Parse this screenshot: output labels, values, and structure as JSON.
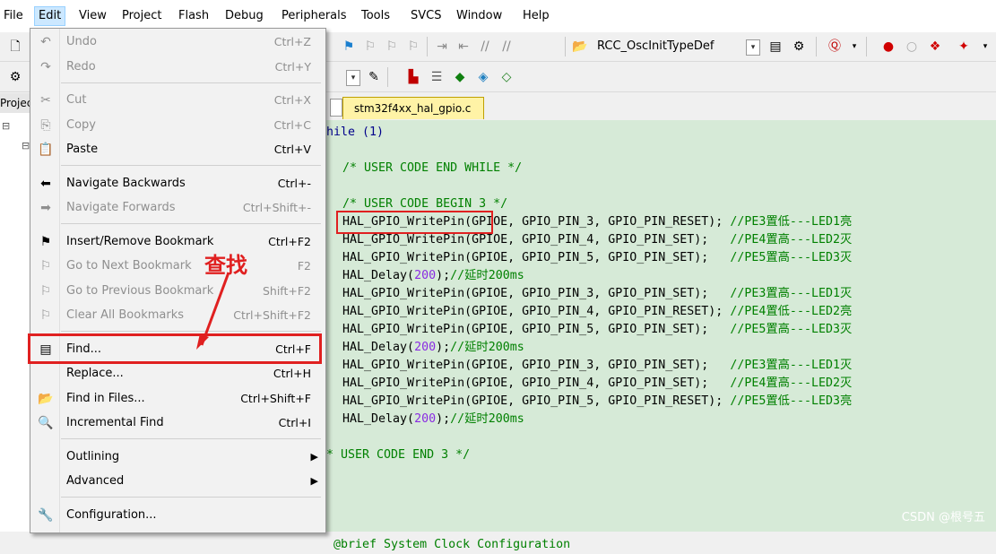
{
  "menubar": {
    "items": [
      "File",
      "Edit",
      "View",
      "Project",
      "Flash",
      "Debug",
      "Peripherals",
      "Tools",
      "SVCS",
      "Window",
      "Help"
    ],
    "active": "Edit"
  },
  "toolbar": {
    "target_select": "RCC_OscInitTypeDef"
  },
  "project_pane": {
    "tab_label": "Project"
  },
  "editor": {
    "file_tab": "stm32f4xx_hal_gpio.c",
    "lines": [
      {
        "text": "hile (1)",
        "cls": "kw"
      },
      {
        "text": "",
        "cls": ""
      },
      {
        "text": " /* USER CODE END WHILE */",
        "cls": "cm"
      },
      {
        "text": "",
        "cls": ""
      },
      {
        "text": " /* USER CODE BEGIN 3 */",
        "cls": "cm"
      },
      {
        "code": " HAL_GPIO_WritePin(GPIOE, GPIO_PIN_3, GPIO_PIN_RESET); ",
        "comment": "//PE3置低---LED1亮"
      },
      {
        "code": " HAL_GPIO_WritePin(GPIOE, GPIO_PIN_4, GPIO_PIN_SET);   ",
        "comment": "//PE4置高---LED2灭"
      },
      {
        "code": " HAL_GPIO_WritePin(GPIOE, GPIO_PIN_5, GPIO_PIN_SET);   ",
        "comment": "//PE5置高---LED3灭"
      },
      {
        "code": " HAL_Delay(",
        "num": "200",
        "code2": ");",
        "comment": "//延时200ms"
      },
      {
        "code": " HAL_GPIO_WritePin(GPIOE, GPIO_PIN_3, GPIO_PIN_SET);   ",
        "comment": "//PE3置高---LED1灭"
      },
      {
        "code": " HAL_GPIO_WritePin(GPIOE, GPIO_PIN_4, GPIO_PIN_RESET); ",
        "comment": "//PE4置低---LED2亮"
      },
      {
        "code": " HAL_GPIO_WritePin(GPIOE, GPIO_PIN_5, GPIO_PIN_SET);   ",
        "comment": "//PE5置高---LED3灭"
      },
      {
        "code": " HAL_Delay(",
        "num": "200",
        "code2": ");",
        "comment": "//延时200ms"
      },
      {
        "code": " HAL_GPIO_WritePin(GPIOE, GPIO_PIN_3, GPIO_PIN_SET);   ",
        "comment": "//PE3置高---LED1灭"
      },
      {
        "code": " HAL_GPIO_WritePin(GPIOE, GPIO_PIN_4, GPIO_PIN_SET);   ",
        "comment": "//PE4置高---LED2灭"
      },
      {
        "code": " HAL_GPIO_WritePin(GPIOE, GPIO_PIN_5, GPIO_PIN_RESET); ",
        "comment": "//PE5置低---LED3亮"
      },
      {
        "code": " HAL_Delay(",
        "num": "200",
        "code2": ");",
        "comment": "//延时200ms"
      },
      {
        "text": "",
        "cls": ""
      },
      {
        "text": "* USER CODE END 3 */",
        "cls": "cm"
      },
      {
        "text": "",
        "cls": ""
      },
      {
        "text": "",
        "cls": ""
      },
      {
        "text": "",
        "cls": ""
      },
      {
        "text": "",
        "cls": ""
      },
      {
        "text": " @brief System Clock Configuration",
        "cls": "cm"
      }
    ],
    "watermark": "CSDN @根号五"
  },
  "edit_menu": {
    "items": [
      {
        "label": "Undo",
        "shortcut": "Ctrl+Z",
        "icon": "undo-icon",
        "glyph": "↶",
        "disabled": true
      },
      {
        "label": "Redo",
        "shortcut": "Ctrl+Y",
        "icon": "redo-icon",
        "glyph": "↷",
        "disabled": true
      },
      {
        "sep": true
      },
      {
        "label": "Cut",
        "shortcut": "Ctrl+X",
        "icon": "cut-icon",
        "glyph": "✂",
        "disabled": true
      },
      {
        "label": "Copy",
        "shortcut": "Ctrl+C",
        "icon": "copy-icon",
        "glyph": "⎘",
        "disabled": true
      },
      {
        "label": "Paste",
        "shortcut": "Ctrl+V",
        "icon": "paste-icon",
        "glyph": "📋",
        "disabled": false
      },
      {
        "sep": true
      },
      {
        "label": "Navigate Backwards",
        "shortcut": "Ctrl+-",
        "icon": "arrow-left-icon",
        "glyph": "⬅",
        "disabled": false
      },
      {
        "label": "Navigate Forwards",
        "shortcut": "Ctrl+Shift+-",
        "icon": "arrow-right-icon",
        "glyph": "➡",
        "disabled": true
      },
      {
        "sep": true
      },
      {
        "label": "Insert/Remove Bookmark",
        "shortcut": "Ctrl+F2",
        "icon": "bookmark-flag-icon",
        "glyph": "⚑",
        "disabled": false
      },
      {
        "label": "Go to Next Bookmark",
        "shortcut": "F2",
        "icon": "next-bookmark-icon",
        "glyph": "⚐",
        "disabled": true
      },
      {
        "label": "Go to Previous Bookmark",
        "shortcut": "Shift+F2",
        "icon": "prev-bookmark-icon",
        "glyph": "⚐",
        "disabled": true
      },
      {
        "label": "Clear All Bookmarks",
        "shortcut": "Ctrl+Shift+F2",
        "icon": "clear-bookmarks-icon",
        "glyph": "⚐",
        "disabled": true
      },
      {
        "sep": true
      },
      {
        "label": "Find...",
        "shortcut": "Ctrl+F",
        "icon": "find-icon",
        "glyph": "▤",
        "disabled": false
      },
      {
        "label": "Replace...",
        "shortcut": "Ctrl+H",
        "icon": "",
        "glyph": "",
        "disabled": false
      },
      {
        "label": "Find in Files...",
        "shortcut": "Ctrl+Shift+F",
        "icon": "find-in-files-icon",
        "glyph": "📂",
        "disabled": false
      },
      {
        "label": "Incremental Find",
        "shortcut": "Ctrl+I",
        "icon": "incremental-find-icon",
        "glyph": "🔍",
        "disabled": false
      },
      {
        "sep": true
      },
      {
        "label": "Outlining",
        "shortcut": "",
        "icon": "",
        "glyph": "",
        "disabled": false,
        "submenu": true
      },
      {
        "label": "Advanced",
        "shortcut": "",
        "icon": "",
        "glyph": "",
        "disabled": false,
        "submenu": true
      },
      {
        "sep": true
      },
      {
        "label": "Configuration...",
        "shortcut": "",
        "icon": "wrench-icon",
        "glyph": "🔧",
        "disabled": false
      }
    ]
  },
  "annotation": {
    "text": "查找"
  },
  "colors": {
    "highlight_red": "#e02020",
    "editor_bg": "#d6ead7",
    "comment_green": "#008000"
  }
}
